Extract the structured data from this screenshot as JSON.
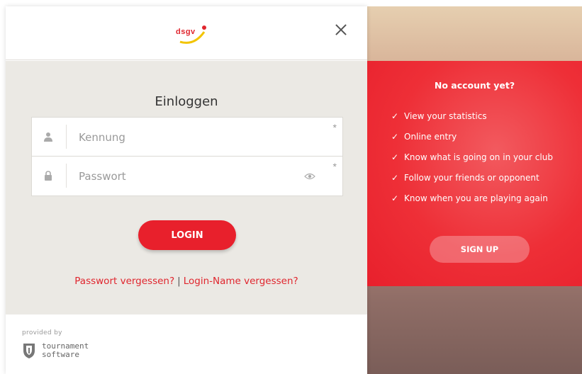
{
  "header": {
    "logo_text": "dsgv",
    "close_icon": "close-icon"
  },
  "login": {
    "title": "Einloggen",
    "username": {
      "placeholder": "Kennung",
      "value": "",
      "required_mark": "*",
      "icon": "user-icon"
    },
    "password": {
      "placeholder": "Passwort",
      "value": "",
      "required_mark": "*",
      "icon": "lock-icon",
      "toggle_icon": "eye-icon"
    },
    "login_label": "LOGIN",
    "forgot_password": "Passwort vergessen?",
    "separator": "|",
    "forgot_login": "Login-Name vergessen?"
  },
  "footer": {
    "provided_by": "provided by",
    "brand_line1": "tournament",
    "brand_line2": "software",
    "brand_icon": "shield-icon"
  },
  "promo": {
    "title": "No account yet?",
    "check_glyph": "✓",
    "benefits": [
      "View your statistics",
      "Online entry",
      "Know what is going on in your club",
      "Follow your friends or opponent",
      "Know when you are playing again"
    ],
    "signup_label": "SIGN UP"
  },
  "colors": {
    "accent": "#e8202c",
    "form_bg": "#ebe9e4",
    "link": "#e0262e"
  }
}
